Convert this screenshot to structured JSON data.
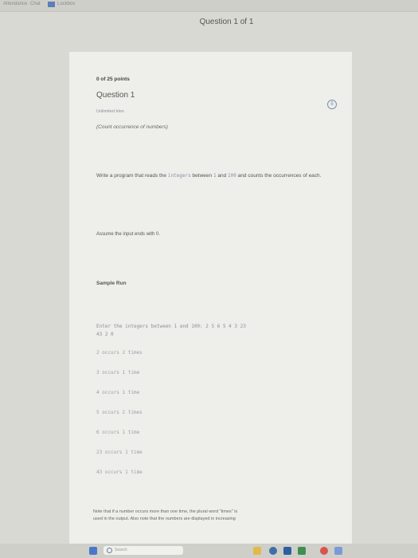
{
  "browser_tabs": [
    "Attendance",
    "Chat",
    "Lockbox"
  ],
  "heading": "Question 1 of 1",
  "points": "0 of 25 points",
  "question_title": "Question 1",
  "attempts": "Unlimited tries",
  "badge": "5",
  "subtitle": "(Count occurrence of numbers)",
  "prompt": {
    "p1": "Write a program that reads the ",
    "code": "integers",
    "p2": " between ",
    "a": "1",
    "p3": " and ",
    "b": "100",
    "p4": " and counts the occurrences of each."
  },
  "assume": "Assume the input ends with 0.",
  "sample_run_title": "Sample Run",
  "sample_input_line1": "Enter the integers between 1 and 100: 2 5 6 5 4 3 23",
  "sample_input_line2": "43 2 0",
  "outputs": [
    "2 occurs 2 times",
    "3 occurs 1 time",
    "4 occurs 1 time",
    "5 occurs 2 times",
    "6 occurs 1 time",
    "23 occurs 1 time",
    "43 occurs 1 time"
  ],
  "note_line1": "Note that if a number occurs more than one time, the plural word \"times\" is",
  "note_line2": "used in the output. Also note that the numbers are displayed in increasing",
  "taskbar": {
    "search_placeholder": "Search"
  },
  "colors": {
    "accent": "#5d7fb8",
    "background": "#d9d9d4"
  }
}
